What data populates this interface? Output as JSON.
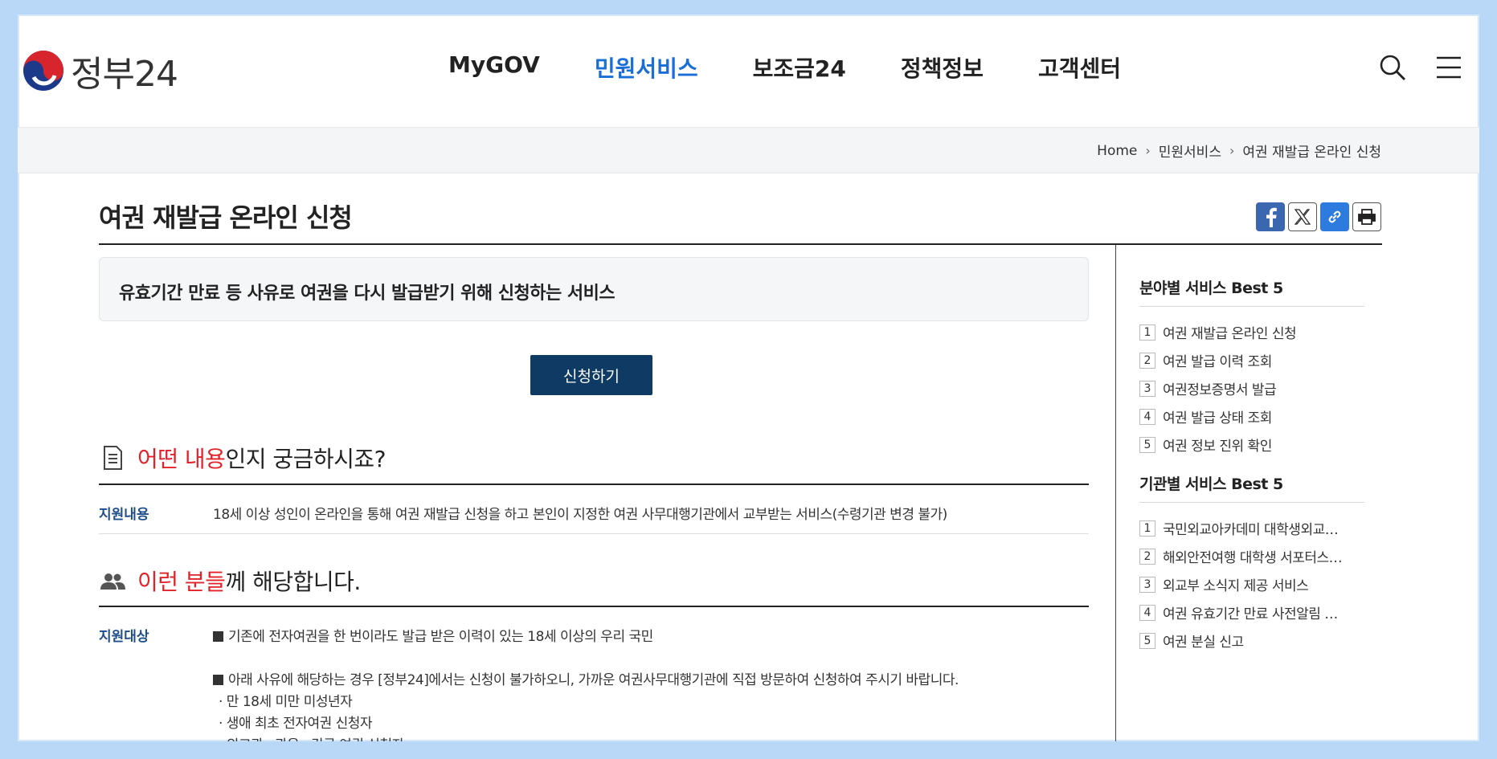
{
  "header": {
    "logo_text": "정부24",
    "nav": [
      "MyGOV",
      "민원서비스",
      "보조금24",
      "정책정보",
      "고객센터"
    ],
    "active_nav": "민원서비스",
    "brand_color": "#1a6fd6"
  },
  "breadcrumb": [
    "Home",
    "민원서비스",
    "여권 재발급 온라인 신청"
  ],
  "page": {
    "title": "여권 재발급 온라인 신청",
    "summary": "유효기간 만료 등 사유로 여권을 다시 발급받기 위해 신청하는 서비스",
    "apply_label": "신청하기"
  },
  "sections": {
    "content": {
      "title_hl": "어떤 내용",
      "title_rest": "인지 궁금하시죠?",
      "label": "지원내용",
      "text": "18세 이상 성인이 온라인을 통해 여권 재발급 신청을 하고 본인이 지정한 여권 사무대행기관에서 교부받는 서비스(수령기관 변경 불가)"
    },
    "target": {
      "title_hl": "이런 분들",
      "title_rest": "께 해당합니다.",
      "label": "지원대상",
      "line1": "기존에 전자여권을 한 번이라도 발급 받은 이력이 있는 18세 이상의 우리 국민",
      "line2": "아래 사유에 해당하는 경우 [정부24]에서는 신청이 불가하오니, 가까운 여권사무대행기관에 직접 방문하여 신청하여 주시기 바랍니다.",
      "sub": [
        "· 만 18세 미만 미성년자",
        "· 생애 최초 전자여권 신청자",
        "· 외교관 · 관용 · 긴급 여권 신청자"
      ]
    }
  },
  "sidebar": {
    "field_title": "분야별 서비스 Best 5",
    "field_items": [
      "여권 재발급 온라인 신청",
      "여권 발급 이력 조회",
      "여권정보증명서 발급",
      "여권 발급 상태 조회",
      "여권 정보 진위 확인"
    ],
    "org_title": "기관별 서비스 Best 5",
    "org_items": [
      "국민외교아카데미 대학생외교…",
      "해외안전여행 대학생 서포터스…",
      "외교부 소식지 제공 서비스",
      "여권 유효기간 만료 사전알림 …",
      "여권 분실 신고"
    ]
  },
  "colors": {
    "highlight": "#e2222a",
    "apply_button": "#0f3a63",
    "label": "#1f4f8a"
  }
}
